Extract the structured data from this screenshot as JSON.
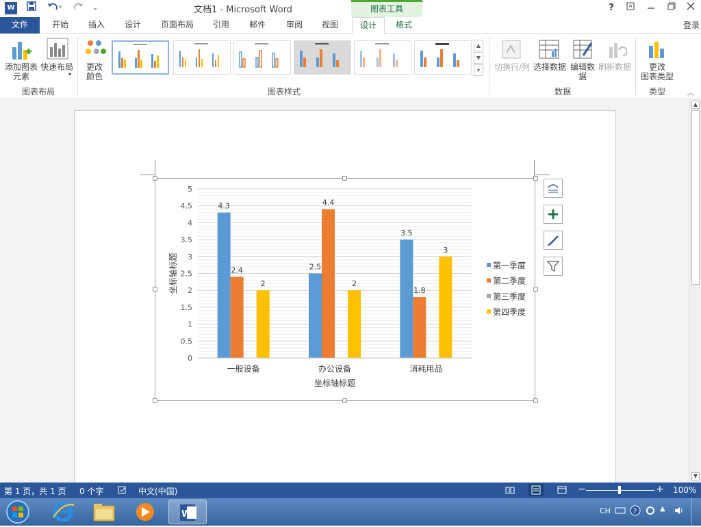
{
  "titlebar": {
    "app_logo": "W",
    "title": "文档1 - Microsoft Word",
    "context_tools": "图表工具",
    "help": "?",
    "icons": [
      "save-icon",
      "undo-icon",
      "redo-icon",
      "customize-qat-icon",
      "help-icon",
      "ribbon-display-icon",
      "minimize-icon",
      "restore-icon",
      "close-icon"
    ]
  },
  "tabs": {
    "file": "文件",
    "home": "开始",
    "insert": "插入",
    "design1": "设计",
    "layout": "页面布局",
    "references": "引用",
    "mailings": "邮件",
    "review": "审阅",
    "view": "视图",
    "chart_design": "设计",
    "chart_format": "格式",
    "login": "登录"
  },
  "ribbon": {
    "add_element": "添加图表\n元素",
    "quick_layout": "快速布局",
    "group_layout": "图表布局",
    "change_colors": "更改\n颜色",
    "group_styles": "图表样式",
    "switch_row_col": "切换行/列",
    "select_data": "选择数据",
    "edit_data": "编辑数\n据",
    "refresh_data": "刷新数据",
    "group_data": "数据",
    "change_type": "更改\n图表类型",
    "group_type": "类型"
  },
  "chart_data": {
    "type": "bar",
    "categories": [
      "一般设备",
      "办公设备",
      "消耗用品"
    ],
    "series": [
      {
        "name": "第一季度",
        "values": [
          4.3,
          2.5,
          3.5
        ],
        "color": "#5b9bd5"
      },
      {
        "name": "第二季度",
        "values": [
          2.4,
          4.4,
          1.8
        ],
        "color": "#ed7d31"
      },
      {
        "name": "第三季度",
        "values": [
          null,
          null,
          null
        ],
        "color": "#a5a5a5"
      },
      {
        "name": "第四季度",
        "values": [
          2,
          2,
          3
        ],
        "color": "#ffc000"
      }
    ],
    "xlabel": "坐标轴标题",
    "ylabel": "坐标轴标题",
    "ylim": [
      0,
      5
    ],
    "yticks": [
      "0",
      "0.5",
      "1",
      "1.5",
      "2",
      "2.5",
      "3",
      "3.5",
      "4",
      "4.5",
      "5"
    ],
    "data_labels": true,
    "grid": true,
    "legend": "right"
  },
  "chart_side_buttons": [
    "chart-layout-icon",
    "chart-elements-plus-icon",
    "chart-styles-brush-icon",
    "chart-filter-icon"
  ],
  "statusbar": {
    "page": "第 1 页，共 1 页",
    "words": "0 个字",
    "language": "中文(中国)",
    "zoom": "100%",
    "zoom_minus": "−",
    "zoom_plus": "+"
  },
  "taskbar": {
    "apps": [
      "start-orb-icon",
      "ie-icon",
      "explorer-icon",
      "media-player-icon",
      "word-icon"
    ],
    "ime": "CH"
  }
}
